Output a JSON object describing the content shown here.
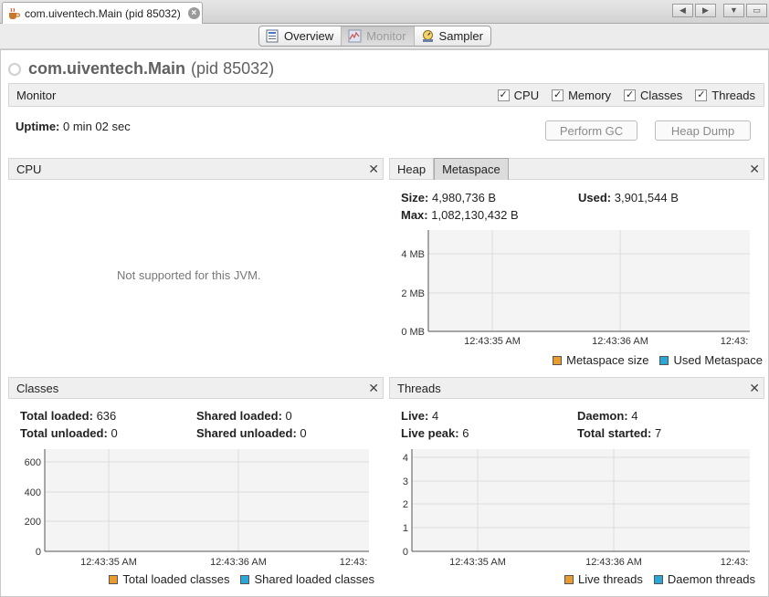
{
  "tab": {
    "title": "com.uiventech.Main (pid 85032)"
  },
  "views": [
    {
      "label": "Overview",
      "icon": "overview-icon"
    },
    {
      "label": "Monitor",
      "icon": "monitor-icon"
    },
    {
      "label": "Sampler",
      "icon": "sampler-icon"
    }
  ],
  "app": {
    "name": "com.uiventech.Main",
    "pid": "(pid 85032)"
  },
  "monitor": {
    "label": "Monitor",
    "checks": [
      {
        "label": "CPU",
        "checked": true
      },
      {
        "label": "Memory",
        "checked": true
      },
      {
        "label": "Classes",
        "checked": true
      },
      {
        "label": "Threads",
        "checked": true
      }
    ],
    "uptime_label": "Uptime:",
    "uptime_value": "0 min 02 sec",
    "gc_button": "Perform GC",
    "heapdump_button": "Heap Dump"
  },
  "cpu": {
    "title": "CPU",
    "message": "Not supported for this JVM."
  },
  "memory": {
    "tabs": [
      "Heap",
      "Metaspace"
    ],
    "size_label": "Size:",
    "size_value": "4,980,736 B",
    "used_label": "Used:",
    "used_value": "3,901,544 B",
    "max_label": "Max:",
    "max_value": "1,082,130,432 B",
    "y_ticks": [
      "4 MB",
      "2 MB",
      "0 MB"
    ],
    "x_ticks": [
      "12:43:35 AM",
      "12:43:36 AM",
      "12:43:"
    ],
    "legend": [
      {
        "label": "Metaspace size",
        "color": "#e89b2f"
      },
      {
        "label": "Used Metaspace",
        "color": "#2aa7d6"
      }
    ]
  },
  "classes": {
    "title": "Classes",
    "total_loaded_label": "Total loaded:",
    "total_loaded_value": "636",
    "shared_loaded_label": "Shared loaded:",
    "shared_loaded_value": "0",
    "total_unloaded_label": "Total unloaded:",
    "total_unloaded_value": "0",
    "shared_unloaded_label": "Shared unloaded:",
    "shared_unloaded_value": "0",
    "y_ticks": [
      "600",
      "400",
      "200",
      "0"
    ],
    "x_ticks": [
      "12:43:35 AM",
      "12:43:36 AM",
      "12:43:"
    ],
    "legend": [
      {
        "label": "Total loaded classes",
        "color": "#e89b2f"
      },
      {
        "label": "Shared loaded classes",
        "color": "#2aa7d6"
      }
    ]
  },
  "threads": {
    "title": "Threads",
    "live_label": "Live:",
    "live_value": "4",
    "daemon_label": "Daemon:",
    "daemon_value": "4",
    "live_peak_label": "Live peak:",
    "live_peak_value": "6",
    "total_started_label": "Total started:",
    "total_started_value": "7",
    "y_ticks": [
      "4",
      "3",
      "2",
      "1",
      "0"
    ],
    "x_ticks": [
      "12:43:35 AM",
      "12:43:36 AM",
      "12:43:"
    ],
    "legend": [
      {
        "label": "Live threads",
        "color": "#e89b2f"
      },
      {
        "label": "Daemon threads",
        "color": "#2aa7d6"
      }
    ]
  }
}
